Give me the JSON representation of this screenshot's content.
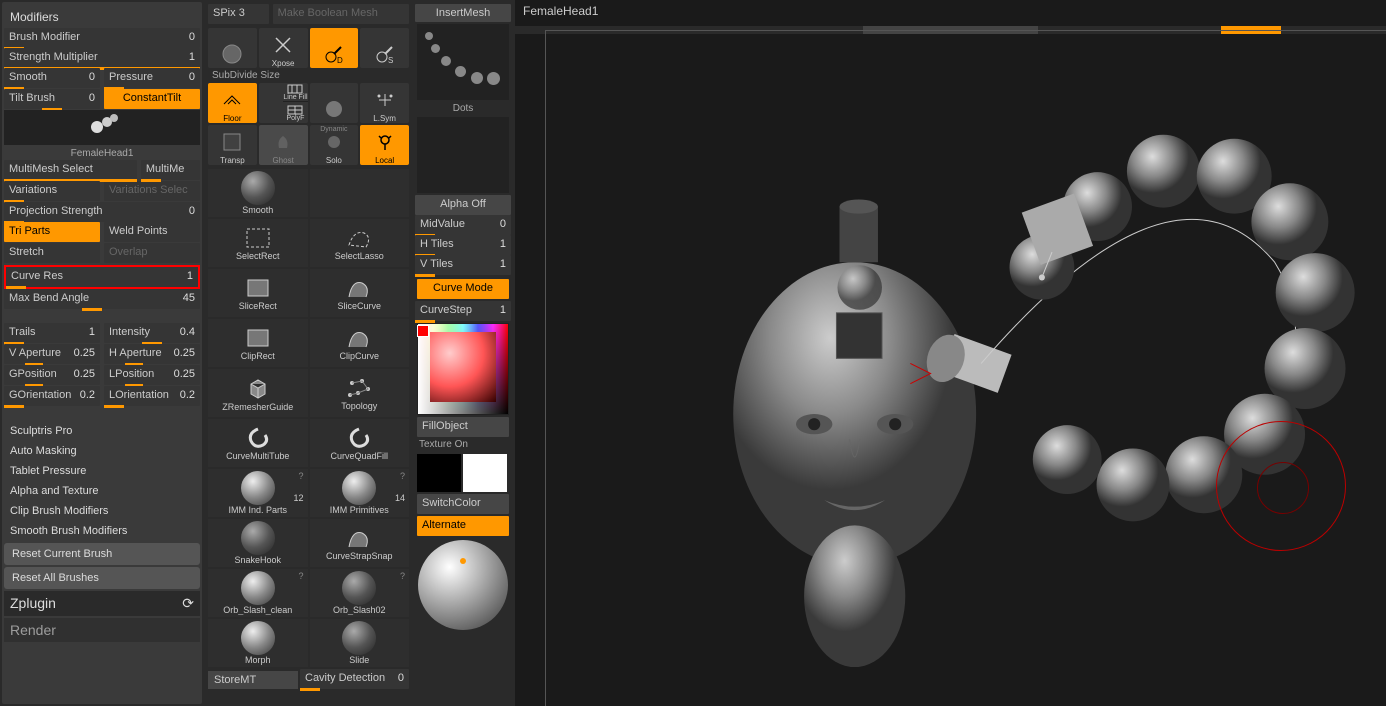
{
  "left_panel": {
    "title": "Modifiers",
    "brush_modifier": {
      "label": "Brush Modifier",
      "value": 0
    },
    "strength_multiplier": {
      "label": "Strength Multiplier",
      "value": 1
    },
    "smooth": {
      "label": "Smooth",
      "value": 0
    },
    "pressure": {
      "label": "Pressure",
      "value": 0
    },
    "tilt_brush": {
      "label": "Tilt Brush",
      "value": 0
    },
    "constant_tilt": "ConstantTilt",
    "mesh_name": "FemaleHead1",
    "multimesh_select": "MultiMesh Select",
    "multimesh_right": "MultiMe",
    "variations": "Variations",
    "variations_select": "Variations Selec",
    "projection_strength": {
      "label": "Projection Strength",
      "value": 0
    },
    "tri_parts": "Tri Parts",
    "weld_points": "Weld Points",
    "stretch": "Stretch",
    "overlap": "Overlap",
    "curve_res": {
      "label": "Curve Res",
      "value": 1
    },
    "max_bend_angle": {
      "label": "Max Bend Angle",
      "value": 45
    },
    "trails": {
      "label": "Trails",
      "value": 1
    },
    "intensity": {
      "label": "Intensity",
      "value": 0.4
    },
    "v_aperture": {
      "label": "V Aperture",
      "value": 0.25
    },
    "h_aperture": {
      "label": "H Aperture",
      "value": 0.25
    },
    "gposition": {
      "label": "GPosition",
      "value": 0.25
    },
    "lposition": {
      "label": "LPosition",
      "value": 0.25
    },
    "gorientation": {
      "label": "GOrientation",
      "value": "0.2"
    },
    "lorientation": {
      "label": "LOrientation",
      "value": "0.2"
    },
    "sections": [
      "Sculptris Pro",
      "Auto Masking",
      "Tablet Pressure",
      "Alpha and Texture",
      "Clip Brush Modifiers",
      "Smooth Brush Modifiers"
    ],
    "reset_current": "Reset Current Brush",
    "reset_all": "Reset All Brushes",
    "zplugin": "Zplugin",
    "render": "Render"
  },
  "mid_panel": {
    "spix": {
      "label": "SPix",
      "value": 3
    },
    "make_boolean": "Make Boolean Mesh",
    "subdivide_size": "SubDivide Size",
    "tool_row1": [
      {
        "name": "xpose-icon",
        "label": "Xpose"
      },
      {
        "name": "add-d-icon",
        "label": ""
      },
      {
        "name": "add-s-icon",
        "label": ""
      }
    ],
    "tool_row2": [
      {
        "name": "floor",
        "label": "Floor",
        "orange": true
      },
      {
        "name": "linefill",
        "label": "Line Fill"
      },
      {
        "name": "polyf",
        "label": "PolyF"
      },
      {
        "name": "sphere1",
        "label": ""
      },
      {
        "name": "lsym",
        "label": "L.Sym"
      }
    ],
    "tool_row3": [
      {
        "name": "transp",
        "label": "Transp"
      },
      {
        "name": "ghost",
        "label": "Ghost"
      },
      {
        "name": "solo",
        "label": "Solo",
        "sub": "Dynamic"
      },
      {
        "name": "local",
        "label": "Local",
        "orange": true
      }
    ],
    "brushes": [
      {
        "name": "Smooth",
        "style": "sphere dark"
      },
      {
        "name": "",
        "style": "blank"
      },
      {
        "name": "SelectRect",
        "style": "dashrect"
      },
      {
        "name": "SelectLasso",
        "style": "dashcurve"
      },
      {
        "name": "SliceRect",
        "style": "rect"
      },
      {
        "name": "SliceCurve",
        "style": "curve"
      },
      {
        "name": "ClipRect",
        "style": "rect"
      },
      {
        "name": "ClipCurve",
        "style": "curve"
      },
      {
        "name": "ZRemesherGuide",
        "style": "cube"
      },
      {
        "name": "Topology",
        "style": "dots"
      },
      {
        "name": "CurveMultiTube",
        "style": "swirl"
      },
      {
        "name": "CurveQuadFill",
        "style": "swirl2"
      },
      {
        "name": "IMM Ind. Parts",
        "count": 12,
        "style": "sphere",
        "q": true
      },
      {
        "name": "IMM Primitives",
        "count": 14,
        "style": "sphere",
        "q": true
      },
      {
        "name": "SnakeHook",
        "style": "sphere dark"
      },
      {
        "name": "CurveStrapSnap",
        "style": "curve2"
      },
      {
        "name": "Orb_Slash_clean",
        "style": "sphere",
        "q": true
      },
      {
        "name": "Orb_Slash02",
        "style": "sphere dark",
        "q": true
      },
      {
        "name": "Morph",
        "style": "sphere"
      },
      {
        "name": "Slide",
        "style": "sphere dark"
      }
    ],
    "store_mt": "StoreMT",
    "cavity_detection": {
      "label": "Cavity Detection",
      "value": 0
    }
  },
  "right_panel": {
    "insert_mesh": "InsertMesh",
    "dots": "Dots",
    "alpha_off": "Alpha Off",
    "midvalue": {
      "label": "MidValue",
      "value": 0
    },
    "htiles": {
      "label": "H Tiles",
      "value": 1
    },
    "vtiles": {
      "label": "V Tiles",
      "value": 1
    },
    "curve_mode": "Curve Mode",
    "curve_step": {
      "label": "CurveStep",
      "value": 1
    },
    "fill_object": "FillObject",
    "texture_on": "Texture On",
    "switch_color": "SwitchColor",
    "alternate": "Alternate"
  },
  "canvas": {
    "title": "FemaleHead1"
  }
}
